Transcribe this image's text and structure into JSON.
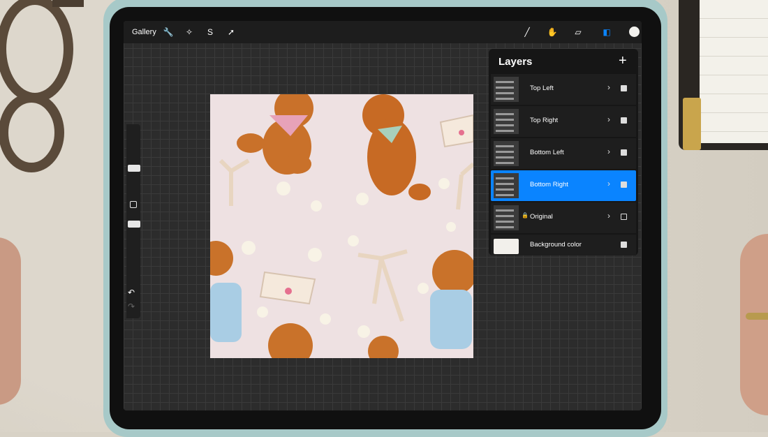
{
  "toolbar": {
    "gallery_label": "Gallery",
    "left_tools": [
      "wrench-icon",
      "magic-wand-icon",
      "selection-icon",
      "transform-arrow-icon"
    ],
    "right_tools": [
      "brush-icon",
      "smudge-icon",
      "eraser-icon",
      "layers-icon"
    ],
    "current_color": "#f2f1ee",
    "layers_active_color": "#0a84ff"
  },
  "layers": {
    "title": "Layers",
    "add_symbol": "+",
    "chevron": "›",
    "items": [
      {
        "label": "Top Left",
        "visible": true,
        "selected": false
      },
      {
        "label": "Top Right",
        "visible": true,
        "selected": false
      },
      {
        "label": "Bottom Left",
        "visible": true,
        "selected": false
      },
      {
        "label": "Bottom Right",
        "visible": true,
        "selected": true
      },
      {
        "label": "Original",
        "visible": false,
        "selected": false,
        "locked": true
      }
    ],
    "background": {
      "label": "Background color",
      "visible": true
    }
  },
  "sidebar": {
    "undo_symbol": "↶",
    "redo_symbol": "↷"
  },
  "colors": {
    "canvas_bg": "#eee1e2",
    "selected_row": "#0a84ff"
  }
}
